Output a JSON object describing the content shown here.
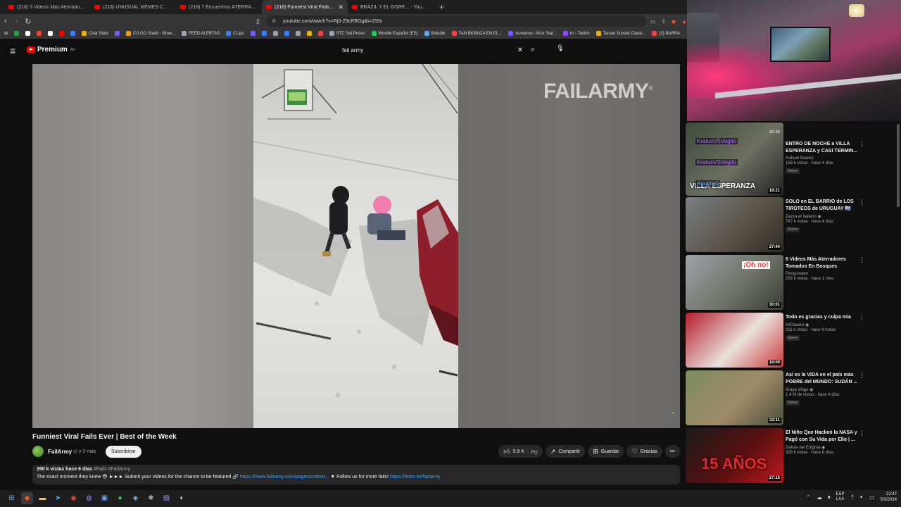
{
  "browser": {
    "tabs": [
      {
        "label": "(218) 5 Videos Más Aterradores Tom",
        "active": false
      },
      {
        "label": "(218) UNUSUAL MEMES COMPILATI",
        "active": false
      },
      {
        "label": "(218) 7 Encuentros ATERRADORES C",
        "active": false
      },
      {
        "label": "(218) Funniest Viral Fails Ever | B",
        "active": true
      },
      {
        "label": "BRAZIL Y EL GORE... - YouTube",
        "active": false
      }
    ],
    "new_tab": "+",
    "url": "youtube.com/watch?v=Rj0-Z9cRBGg&t=159s",
    "bookmarks": [
      {
        "label": "",
        "color": "#2ea043"
      },
      {
        "label": "",
        "color": "#ffffff"
      },
      {
        "label": "",
        "color": "#e8452c"
      },
      {
        "label": "",
        "color": "#ffffff"
      },
      {
        "label": "",
        "color": "#ff0000"
      },
      {
        "label": "",
        "color": "#3b82f6"
      },
      {
        "label": "Chat Stats",
        "color": "#eab308"
      },
      {
        "label": "",
        "color": "#6d5dfc"
      },
      {
        "label": "CS.GO Stash - Brow...",
        "color": "#f59e0b"
      },
      {
        "label": "FEED ALERTAS",
        "color": "#9ca3af"
      },
      {
        "label": "CLips",
        "color": "#3b82f6"
      },
      {
        "label": "",
        "color": "#6d5dfc"
      },
      {
        "label": "",
        "color": "#3b82f6"
      },
      {
        "label": "",
        "color": "#9ca3af"
      },
      {
        "label": "",
        "color": "#3b82f6"
      },
      {
        "label": "",
        "color": "#9ca3af"
      },
      {
        "label": "",
        "color": "#eab308"
      },
      {
        "label": "",
        "color": "#ef4444"
      },
      {
        "label": "STC Set Prices",
        "color": "#9ca3af"
      },
      {
        "label": "Wordle Español (ES)",
        "color": "#22c55e"
      },
      {
        "label": "Boludle",
        "color": "#60a5fa"
      },
      {
        "label": "TAN BIONICA EN EL...",
        "color": "#ef4444"
      },
      {
        "label": "siomeron - Kick Stat...",
        "color": "#6d5dfc"
      },
      {
        "label": "trr - Twitch",
        "color": "#9146ff"
      },
      {
        "label": "Tanuki Sunset Classi...",
        "color": "#eab308"
      },
      {
        "label": "(2) BARRA",
        "color": "#ef4444"
      }
    ]
  },
  "youtube": {
    "logo_text": "Premium",
    "logo_region": "AR",
    "search_value": "fail army",
    "video": {
      "watermark": "FAILARMY",
      "watermark_mark": "®",
      "title": "Funniest Viral Fails Ever | Best of the Week",
      "channel": "FailArmy",
      "channel_meta": "◎ y 3 más",
      "subscribe": "Suscribirse",
      "likes": "5.9 K",
      "share": "Compartir",
      "save": "Guardar",
      "thanks": "Gracias",
      "more": "•••",
      "views_date": "390 k vistas  hace 6 días",
      "tags": "#Fails #FailArmy",
      "description_text": "The exact moment they knew 😳 ►►► Submit your videos for the chance to be featured 🔗",
      "link1": "https://www.failarmy.com/pages/submit...",
      "follow_text": "▼ Follow us for more fails!",
      "link2": "https://linktr.ee/failarmy"
    },
    "recommendations": [
      {
        "title": "ENTRO DE NOCHE a VILLA ESPERANZA y CASI TERMIN...",
        "channel": "Nahuel Suarez",
        "meta": "158 k vistas · hace 4 días",
        "badge": "Nuevo",
        "duration": "18:21",
        "top_duration": "26:36",
        "thumb_text": "VILLA ESPERANZA",
        "overlay1": "KratosVSVegito",
        "overlay2": "KratosVSVegito",
        "overlay3": "Agustip0",
        "colors": [
          "#3d4a3a",
          "#6d6f62",
          "#222"
        ]
      },
      {
        "title": "SOLO en EL BARRIO de LOS TIROTEOS de URUGUAY 🇺🇾",
        "channel": "Zazza el Italiano ◉",
        "meta": "767 k vistas · hace 4 días",
        "badge": "Nuevo",
        "duration": "27:44",
        "colors": [
          "#7a7f83",
          "#5a5449",
          "#2f2a25"
        ]
      },
      {
        "title": "6 Videos Más Aterradores Tomados En Bosques",
        "channel": "Penguinator",
        "meta": "293 k vistas · hace 1 mes",
        "badge": "",
        "duration": "30:01",
        "thumb_text": "¡Oh no!",
        "colors": [
          "#9ea3a8",
          "#6f7368",
          "#3a3c36"
        ]
      },
      {
        "title": "Todo es gracias y culpa mía",
        "channel": "HiClavero ◉",
        "meta": "211 k vistas · hace 9 horas",
        "badge": "Nuevo",
        "duration": "18:00",
        "colors": [
          "#b71c2a",
          "#e8e2dc",
          "#c93a3a"
        ]
      },
      {
        "title": "Así es la VIDA en el país más POBRE del MUNDO: SUDÁN ...",
        "channel": "Araya Vlogs ◉",
        "meta": "1.4 M de vistas · hace 4 días",
        "badge": "Nuevo",
        "duration": "22:11",
        "colors": [
          "#7b8c5e",
          "#a08a6a",
          "#4a4f3a"
        ]
      },
      {
        "title": "El Niño Que Hackeó la NASA y Pagó con Su Vida por Ello | ...",
        "channel": "Detrás del Enigma ◉",
        "meta": "328 k vistas · hace 8 días",
        "badge": "",
        "duration": "27:15",
        "thumb_text": "15 AÑOS",
        "colors": [
          "#1a1a1a",
          "#5a1010",
          "#c0181c"
        ]
      }
    ]
  },
  "taskbar": {
    "lang_top": "ESP",
    "lang_bottom": "LAA",
    "time": "22:47",
    "date": "5/3/2026"
  }
}
